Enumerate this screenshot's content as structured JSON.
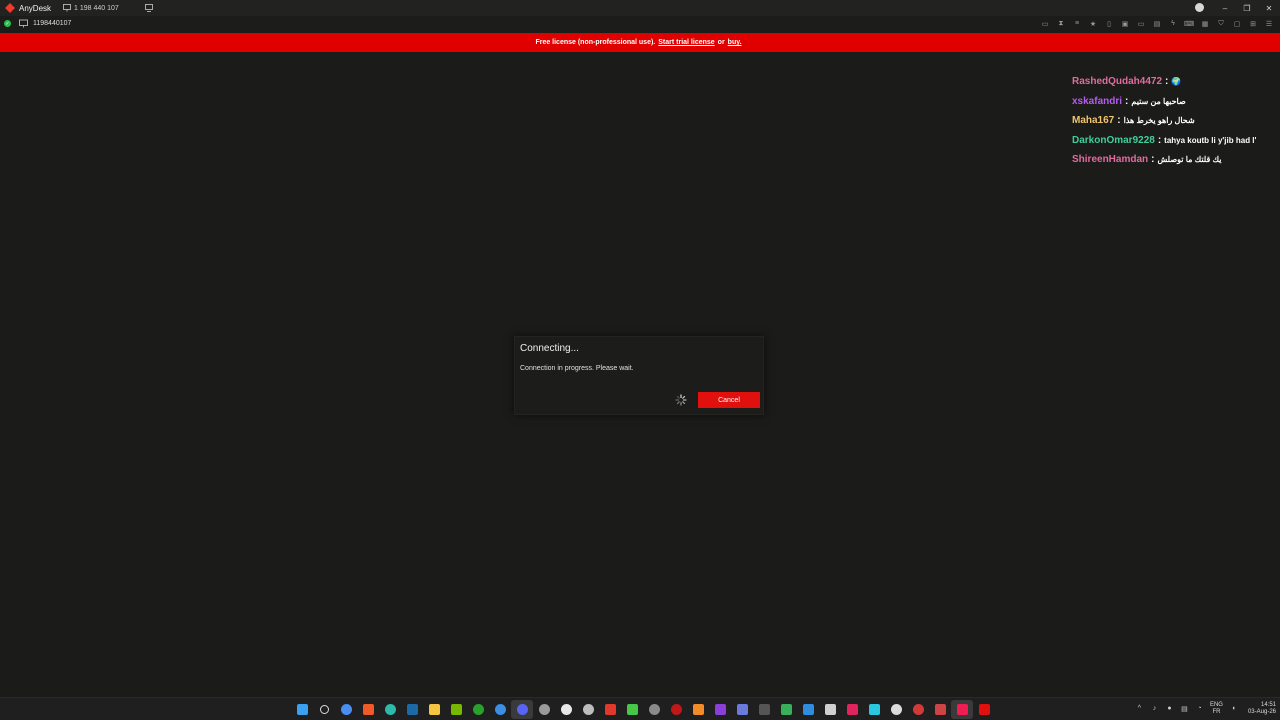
{
  "titlebar": {
    "app_name": "AnyDesk",
    "tab_id": "1 198 440 107"
  },
  "window_controls": {
    "minimize": "–",
    "restore": "❐",
    "close": "✕"
  },
  "addressbar": {
    "address": "1198440107"
  },
  "banner": {
    "text_prefix": "Free license (non-professional use).",
    "trial_link": "Start trial license",
    "text_or": "or",
    "buy_link": "buy."
  },
  "chat": [
    {
      "user": "RashedQudah4472",
      "color": "#e06c9f",
      "message": "🌍"
    },
    {
      "user": "xskafandri",
      "color": "#b65cf0",
      "message": "صاحبها من ستيم"
    },
    {
      "user": "Maha167",
      "color": "#f2c46d",
      "message": "شحال راهو يخرط هذا"
    },
    {
      "user": "DarkonOmar9228",
      "color": "#3fcf9c",
      "message": "tahya koutb li y'jib had l'"
    },
    {
      "user": "ShireenHamdan",
      "color": "#e06c9f",
      "message": "يك قلتك ما توصلش"
    }
  ],
  "dialog": {
    "title": "Connecting...",
    "message": "Connection in progress. Please wait.",
    "cancel_label": "Cancel"
  },
  "tray": {
    "lang_top": "ENG",
    "lang_bottom": "FR",
    "time": "14:51",
    "date": "03-Aug-26"
  },
  "colors": {
    "accent": "#e00000",
    "background": "#1b1b19"
  }
}
